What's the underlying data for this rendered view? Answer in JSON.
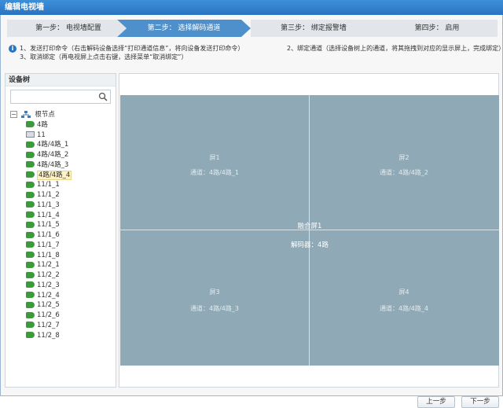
{
  "window": {
    "title": "编辑电视墙"
  },
  "steps": [
    {
      "label": "第一步：  电视墙配置",
      "active": false
    },
    {
      "label": "第二步：  选择解码通道",
      "active": true
    },
    {
      "label": "第三步：  绑定报警墙",
      "active": false
    },
    {
      "label": "第四步：  启用",
      "active": false
    }
  ],
  "instructions": {
    "line1": "1、发送打印命令（右击解码设备选择“打印通道信息”，将向设备发送打印命令）",
    "line2": "3、取消绑定（再电视屏上点击右键，选择菜单“取消绑定”）",
    "line3": "2、绑定通道（选择设备树上的通道，将其拖拽到对应的显示屏上，完成绑定）"
  },
  "tree": {
    "title": "设备树",
    "search_placeholder": "",
    "root": {
      "label": "根节点",
      "expander": "−"
    },
    "items": [
      {
        "label": "4路",
        "icon": "camera-icon"
      },
      {
        "label": "11",
        "icon": "monitor-icon"
      },
      {
        "label": "4路/4路_1",
        "icon": "camera-icon"
      },
      {
        "label": "4路/4路_2",
        "icon": "camera-icon"
      },
      {
        "label": "4路/4路_3",
        "icon": "camera-icon"
      },
      {
        "label": "4路/4路_4",
        "icon": "camera-icon",
        "selected": true
      },
      {
        "label": "11/1_1",
        "icon": "camera-icon"
      },
      {
        "label": "11/1_2",
        "icon": "camera-icon"
      },
      {
        "label": "11/1_3",
        "icon": "camera-icon"
      },
      {
        "label": "11/1_4",
        "icon": "camera-icon"
      },
      {
        "label": "11/1_5",
        "icon": "camera-icon"
      },
      {
        "label": "11/1_6",
        "icon": "camera-icon"
      },
      {
        "label": "11/1_7",
        "icon": "camera-icon"
      },
      {
        "label": "11/1_8",
        "icon": "camera-icon"
      },
      {
        "label": "11/2_1",
        "icon": "camera-icon"
      },
      {
        "label": "11/2_2",
        "icon": "camera-icon"
      },
      {
        "label": "11/2_3",
        "icon": "camera-icon"
      },
      {
        "label": "11/2_4",
        "icon": "camera-icon"
      },
      {
        "label": "11/2_5",
        "icon": "camera-icon"
      },
      {
        "label": "11/2_6",
        "icon": "camera-icon"
      },
      {
        "label": "11/2_7",
        "icon": "camera-icon"
      },
      {
        "label": "11/2_8",
        "icon": "camera-icon"
      }
    ]
  },
  "wall": {
    "fused_label": "融合屏1",
    "decoder_label": "解码器：4路",
    "screens": [
      {
        "name": "屏1",
        "channel": "通道：4路/4路_1"
      },
      {
        "name": "屏2",
        "channel": "通道：4路/4路_2"
      },
      {
        "name": "屏3",
        "channel": "通道：4路/4路_3"
      },
      {
        "name": "屏4",
        "channel": "通道：4路/4路_4"
      }
    ]
  },
  "buttons": {
    "prev": "上一步",
    "next": "下一步"
  },
  "colors": {
    "titlebar": "#2a74c2",
    "active_step": "#4e90cc",
    "wall": "#8fa9b6",
    "camera": "#3c9a3c"
  }
}
